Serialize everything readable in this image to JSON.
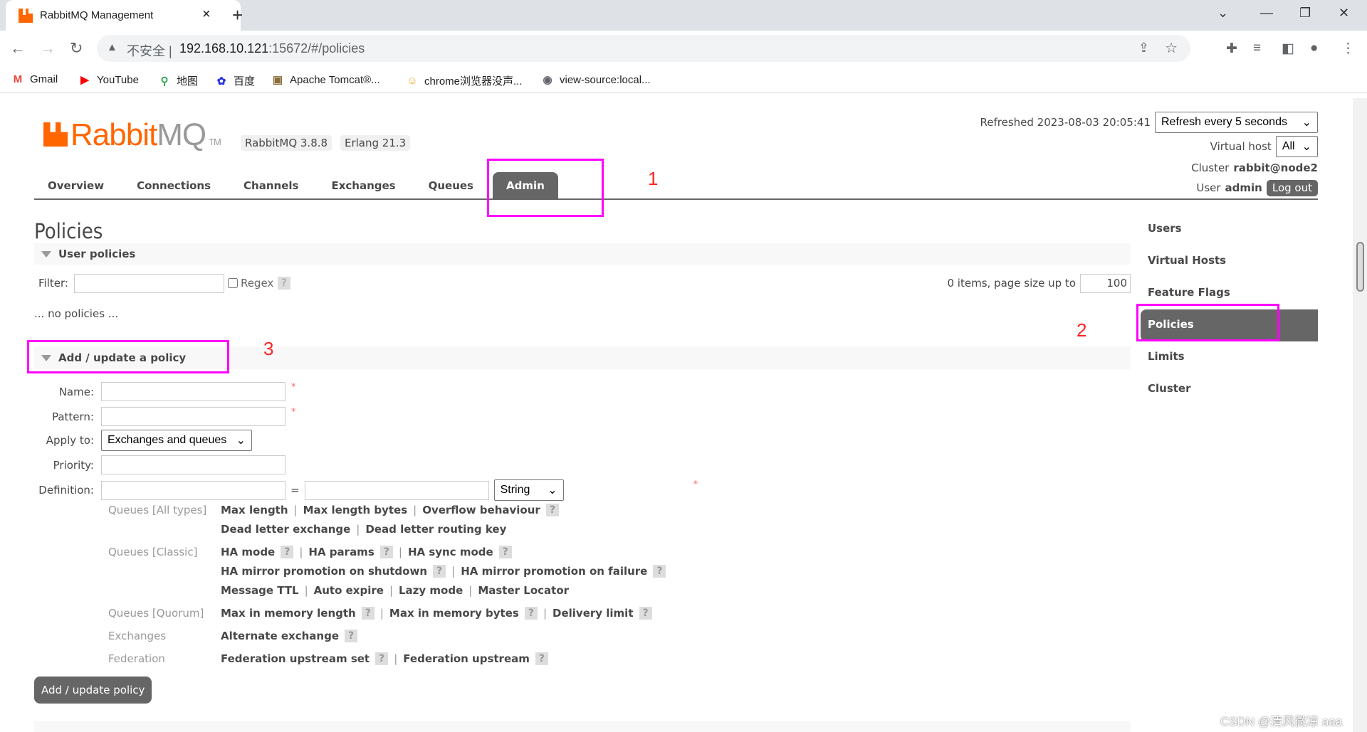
{
  "browser": {
    "tab_title": "RabbitMQ Management",
    "new_tab": "+",
    "close": "×",
    "url_warning": "不安全",
    "url_host": "192.168.10.121",
    "url_rest": ":15672/#/policies",
    "bookmarks": [
      {
        "icon": "gmail-icon",
        "label": "Gmail",
        "glyph": "M",
        "color": "#ea4335"
      },
      {
        "icon": "youtube-icon",
        "label": "YouTube",
        "glyph": "▶",
        "color": "#f00"
      },
      {
        "icon": "maps-icon",
        "label": "地图",
        "glyph": "⚲",
        "color": "#34a853"
      },
      {
        "icon": "baidu-icon",
        "label": "百度",
        "glyph": "✿",
        "color": "#2932e1"
      },
      {
        "icon": "tomcat-icon",
        "label": "Apache Tomcat®...",
        "glyph": "▣",
        "color": "#8a6d3b"
      },
      {
        "icon": "chrome-ext-icon",
        "label": "chrome浏览器没声...",
        "glyph": "☺",
        "color": "#f5a623"
      },
      {
        "icon": "globe-icon",
        "label": "view-source:local...",
        "glyph": "◉",
        "color": "#5f6368"
      }
    ]
  },
  "header": {
    "logo_rabbit": "Rabbit",
    "logo_mq": "MQ",
    "logo_tm": "TM",
    "version": "RabbitMQ 3.8.8",
    "erlang": "Erlang 21.3",
    "refreshed_label": "Refreshed 2023-08-03 20:05:41",
    "refresh_select": "Refresh every 5 seconds",
    "vhost_label": "Virtual host",
    "vhost_select": "All",
    "cluster_label": "Cluster",
    "cluster_name": "rabbit@node2",
    "user_label": "User",
    "user_name": "admin",
    "logout": "Log out"
  },
  "nav": [
    {
      "label": "Overview"
    },
    {
      "label": "Connections"
    },
    {
      "label": "Channels"
    },
    {
      "label": "Exchanges"
    },
    {
      "label": "Queues"
    },
    {
      "label": "Admin",
      "active": true
    }
  ],
  "main": {
    "title": "Policies",
    "user_policies": "User policies",
    "filter_label": "Filter:",
    "filter_value": "",
    "regex_label": "Regex",
    "help": "?",
    "items_text": "0 items, page size up to",
    "page_size": "100",
    "no_policies": "... no policies ...",
    "add_section": "Add / update a policy",
    "form": {
      "name_label": "Name:",
      "pattern_label": "Pattern:",
      "apply_label": "Apply to:",
      "apply_value": "Exchanges and queues",
      "priority_label": "Priority:",
      "definition_label": "Definition:",
      "equals": "=",
      "type_value": "String",
      "required": "*"
    },
    "definition_groups": [
      {
        "category": "Queues [All types]",
        "lines": [
          [
            {
              "t": "Max length"
            },
            {
              "t": "Max length bytes"
            },
            {
              "t": "Overflow behaviour",
              "help": true
            }
          ],
          [
            {
              "t": "Dead letter exchange"
            },
            {
              "t": "Dead letter routing key"
            }
          ]
        ]
      },
      {
        "category": "Queues [Classic]",
        "lines": [
          [
            {
              "t": "HA mode",
              "help": true
            },
            {
              "t": "HA params",
              "help": true
            },
            {
              "t": "HA sync mode",
              "help": true
            }
          ],
          [
            {
              "t": "HA mirror promotion on shutdown",
              "help": true
            },
            {
              "t": "HA mirror promotion on failure",
              "help": true
            }
          ],
          [
            {
              "t": "Message TTL"
            },
            {
              "t": "Auto expire"
            },
            {
              "t": "Lazy mode"
            },
            {
              "t": "Master Locator"
            }
          ]
        ]
      },
      {
        "category": "Queues [Quorum]",
        "lines": [
          [
            {
              "t": "Max in memory length",
              "help": true
            },
            {
              "t": "Max in memory bytes",
              "help": true
            },
            {
              "t": "Delivery limit",
              "help": true
            }
          ]
        ]
      },
      {
        "category": "Exchanges",
        "lines": [
          [
            {
              "t": "Alternate exchange",
              "help": true
            }
          ]
        ]
      },
      {
        "category": "Federation",
        "lines": [
          [
            {
              "t": "Federation upstream set",
              "help": true
            },
            {
              "t": "Federation upstream",
              "help": true
            }
          ]
        ]
      }
    ],
    "submit": "Add / update policy"
  },
  "sidebar": [
    {
      "label": "Users"
    },
    {
      "label": "Virtual Hosts"
    },
    {
      "label": "Feature Flags"
    },
    {
      "label": "Policies",
      "active": true
    },
    {
      "label": "Limits"
    },
    {
      "label": "Cluster"
    }
  ],
  "annotations": {
    "one": "1",
    "two": "2",
    "three": "3",
    "color": "#ff00ff"
  },
  "watermark": "CSDN @清风微凉 aaa"
}
